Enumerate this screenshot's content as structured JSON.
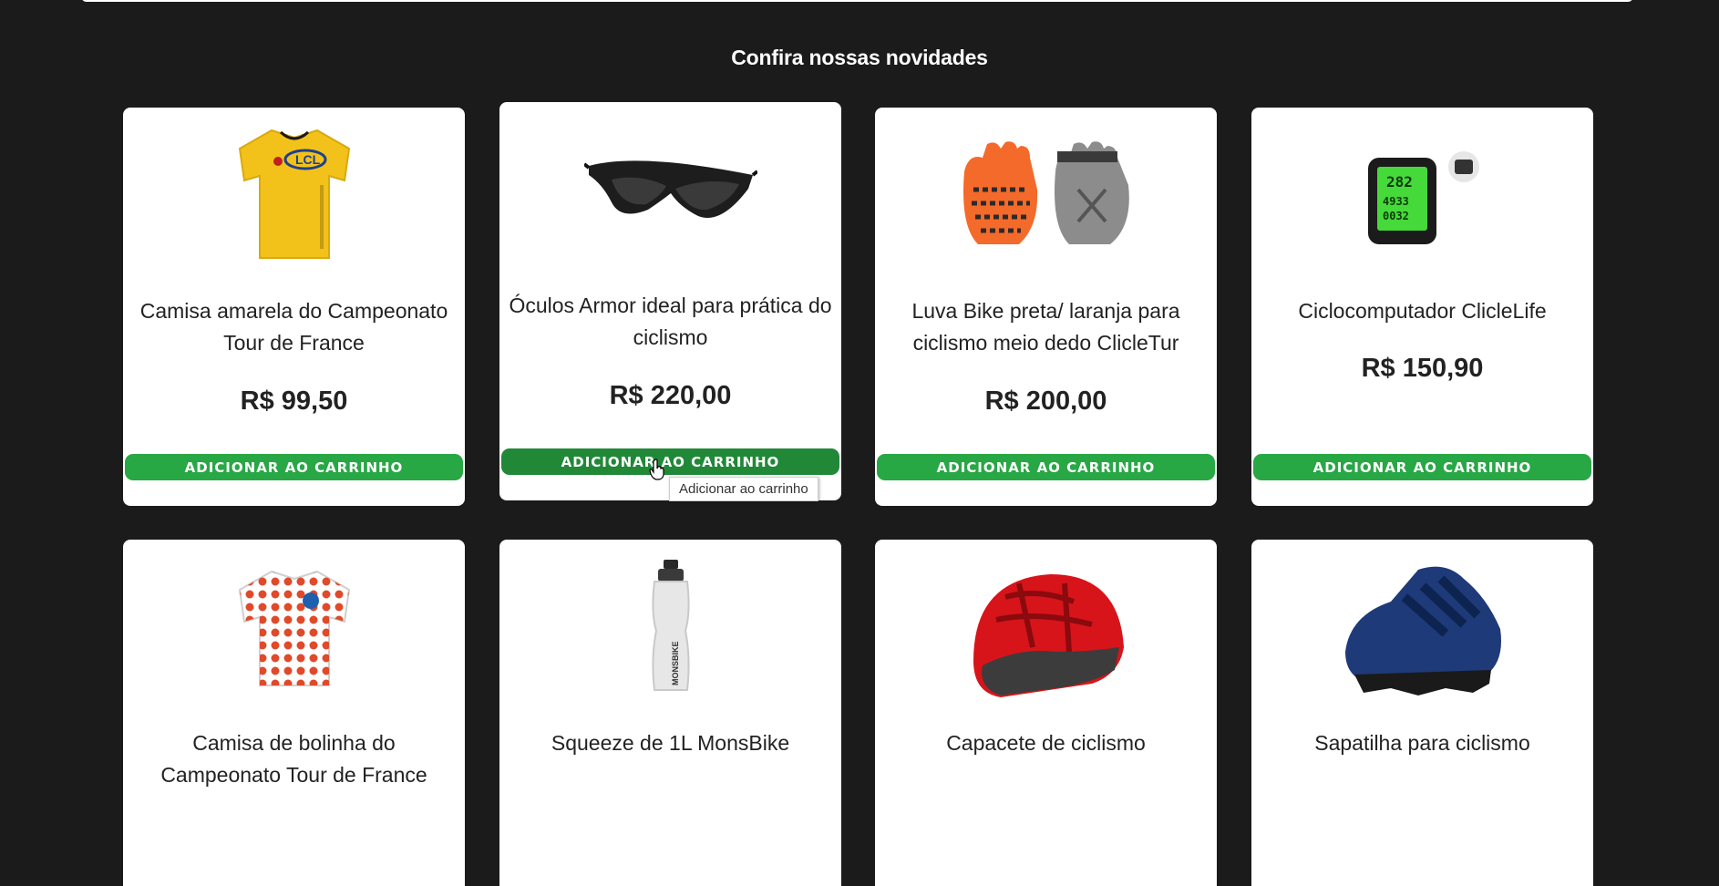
{
  "section": {
    "title": "Confira nossas novidades"
  },
  "button_label": "ADICIONAR AO CARRINHO",
  "tooltip": "Adicionar ao carrinho",
  "accent_color": "#28a745",
  "products": [
    {
      "name": "Camisa amarela do Campeonato Tour de France",
      "price": "R$ 99,50",
      "icon": "yellow-jersey-image"
    },
    {
      "name": "Óculos Armor ideal para prática do ciclismo",
      "price": "R$ 220,00",
      "icon": "sunglasses-image"
    },
    {
      "name": "Luva Bike preta/ laranja para ciclismo meio dedo ClicleTur",
      "price": "R$ 200,00",
      "icon": "gloves-image"
    },
    {
      "name": "Ciclocomputador ClicleLife",
      "price": "R$ 150,90",
      "icon": "bike-computer-image"
    },
    {
      "name": "Camisa de bolinha do Campeonato Tour de France",
      "icon": "polka-dot-jersey-image"
    },
    {
      "name": "Squeeze de 1L MonsBike",
      "icon": "water-bottle-image"
    },
    {
      "name": "Capacete de ciclismo",
      "icon": "helmet-image"
    },
    {
      "name": "Sapatilha para ciclismo",
      "icon": "cycling-shoe-image"
    }
  ]
}
